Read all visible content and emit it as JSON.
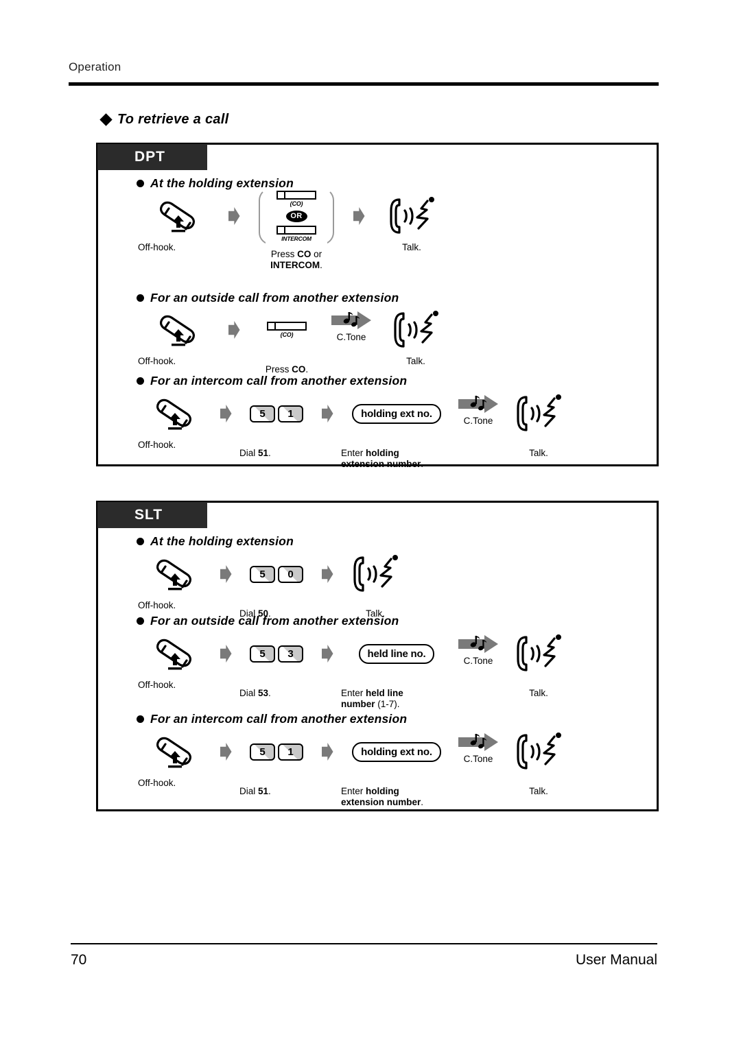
{
  "header": {
    "label": "Operation"
  },
  "section": {
    "title": "To retrieve a call"
  },
  "panels": [
    {
      "tab": "DPT",
      "groups": [
        {
          "heading": "At the holding extension",
          "steps": [
            {
              "glyph": "offhook-handset-icon",
              "caption": "Off-hook."
            },
            {
              "glyph": "arrow-icon"
            },
            {
              "glyph": "co-or-intercom-icon",
              "co_label": "(CO)",
              "or_label": "OR",
              "intercom_label": "INTERCOM",
              "caption_line1": "Press <b>CO</b> or",
              "caption_line2": "<b>INTERCOM</b>."
            },
            {
              "glyph": "arrow-icon"
            },
            {
              "glyph": "talk-icon",
              "caption": "Talk."
            }
          ]
        },
        {
          "heading": "For an outside call from another extension",
          "steps": [
            {
              "glyph": "offhook-handset-icon",
              "caption": "Off-hook."
            },
            {
              "glyph": "arrow-icon"
            },
            {
              "glyph": "co-button-icon",
              "co_label": "(CO)",
              "caption": "Press <b>CO</b>."
            },
            {
              "glyph": "ctone-arrow-icon",
              "ctone_label": "C.Tone"
            },
            {
              "glyph": "talk-icon",
              "caption": "Talk."
            }
          ]
        },
        {
          "heading": "For an intercom call from another extension",
          "steps": [
            {
              "glyph": "offhook-handset-icon",
              "caption": "Off-hook."
            },
            {
              "glyph": "arrow-icon"
            },
            {
              "glyph": "dial-keys-icon",
              "keys": [
                "5",
                "1"
              ],
              "caption": "Dial <b>51</b>."
            },
            {
              "glyph": "arrow-icon"
            },
            {
              "glyph": "capsule-icon",
              "capsule": "holding ext no.",
              "caption_line1": "Enter <b>holding</b>",
              "caption_line2": "<b>extension number</b>."
            },
            {
              "glyph": "ctone-arrow-icon",
              "ctone_label": "C.Tone"
            },
            {
              "glyph": "talk-icon",
              "caption": "Talk."
            }
          ]
        }
      ]
    },
    {
      "tab": "SLT",
      "groups": [
        {
          "heading": "At the holding extension",
          "steps": [
            {
              "glyph": "offhook-handset-icon",
              "caption": "Off-hook."
            },
            {
              "glyph": "arrow-icon"
            },
            {
              "glyph": "dial-keys-icon",
              "keys": [
                "5",
                "0"
              ],
              "caption": "Dial <b>50</b>."
            },
            {
              "glyph": "arrow-icon"
            },
            {
              "glyph": "talk-icon",
              "caption": "Talk."
            }
          ]
        },
        {
          "heading": "For an outside call from another extension",
          "steps": [
            {
              "glyph": "offhook-handset-icon",
              "caption": "Off-hook."
            },
            {
              "glyph": "arrow-icon"
            },
            {
              "glyph": "dial-keys-icon",
              "keys": [
                "5",
                "3"
              ],
              "caption": "Dial <b>53</b>."
            },
            {
              "glyph": "arrow-icon"
            },
            {
              "glyph": "capsule-icon",
              "capsule": "held line no.",
              "caption_line1": "Enter <b>held line</b>",
              "caption_line2": "<b>number</b> (1-7)."
            },
            {
              "glyph": "ctone-arrow-icon",
              "ctone_label": "C.Tone"
            },
            {
              "glyph": "talk-icon",
              "caption": "Talk."
            }
          ]
        },
        {
          "heading": "For an intercom call from another extension",
          "steps": [
            {
              "glyph": "offhook-handset-icon",
              "caption": "Off-hook."
            },
            {
              "glyph": "arrow-icon"
            },
            {
              "glyph": "dial-keys-icon",
              "keys": [
                "5",
                "1"
              ],
              "caption": "Dial <b>51</b>."
            },
            {
              "glyph": "arrow-icon"
            },
            {
              "glyph": "capsule-icon",
              "capsule": "holding ext no.",
              "caption_line1": "Enter <b>holding</b>",
              "caption_line2": "<b>extension number</b>."
            },
            {
              "glyph": "ctone-arrow-icon",
              "ctone_label": "C.Tone"
            },
            {
              "glyph": "talk-icon",
              "caption": "Talk."
            }
          ]
        }
      ]
    }
  ],
  "footer": {
    "page_number": "70",
    "manual_title": "User Manual"
  },
  "colors": {
    "tab_background": "#2b2b2b",
    "arrow_gray": "#7a7a7a",
    "key_shade": "#c9c9c9",
    "rule_black": "#000000"
  }
}
